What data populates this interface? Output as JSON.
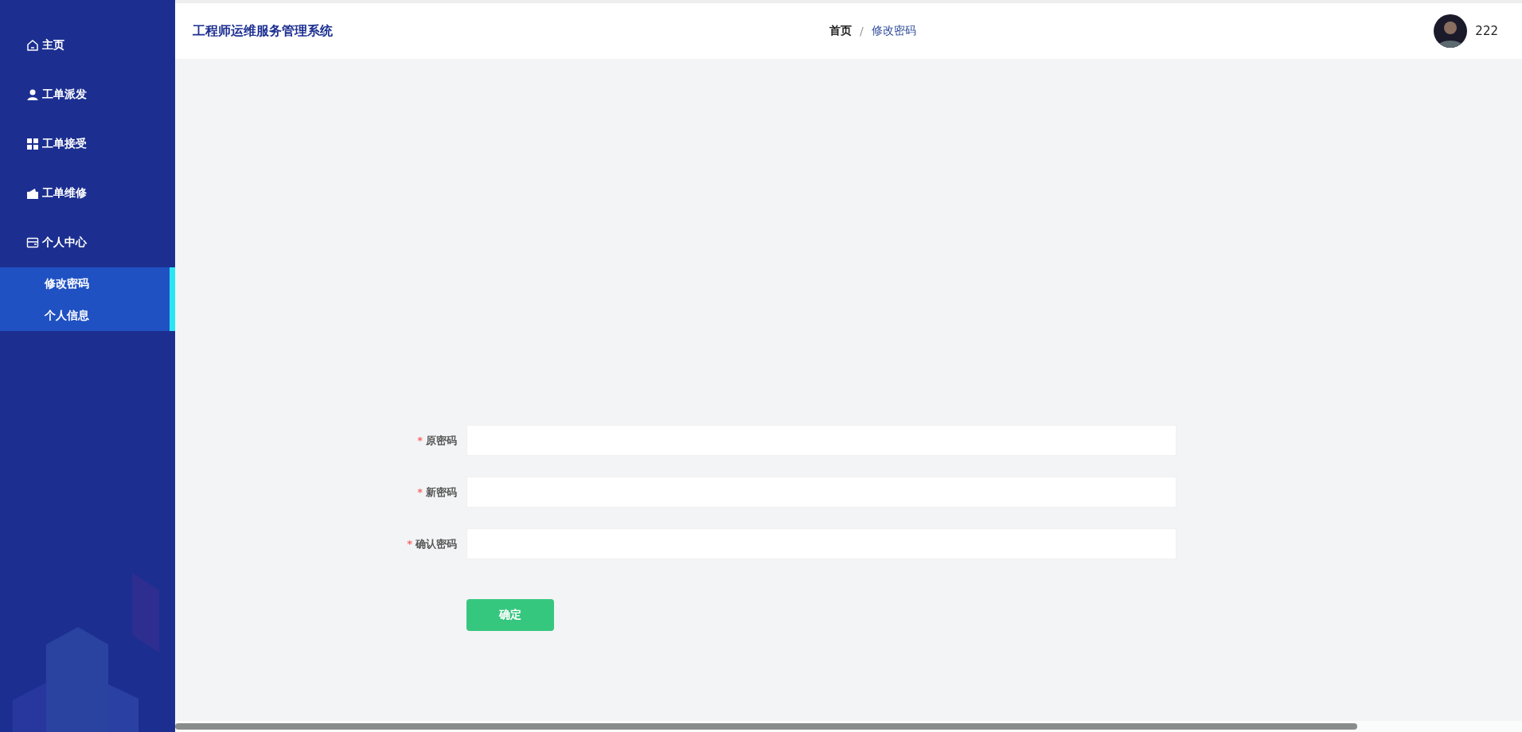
{
  "sidebar": {
    "items": [
      {
        "label": "主页",
        "kind": "home"
      },
      {
        "label": "工单派发",
        "kind": "person"
      },
      {
        "label": "工单接受",
        "kind": "grid"
      },
      {
        "label": "工单维修",
        "kind": "wallet"
      },
      {
        "label": "个人中心",
        "kind": "card",
        "expanded": true,
        "children": [
          {
            "label": "修改密码"
          },
          {
            "label": "个人信息"
          }
        ]
      }
    ]
  },
  "header": {
    "title": "工程师运维服务管理系统",
    "breadcrumb": [
      "首页",
      "修改密码"
    ],
    "breadcrumb_separator": "/",
    "user": "222"
  },
  "form": {
    "fields": [
      {
        "label": "原密码",
        "required_mark": "*"
      },
      {
        "label": "新密码",
        "required_mark": "*"
      },
      {
        "label": "确认密码",
        "required_mark": "*"
      }
    ],
    "submit": "确定"
  }
}
